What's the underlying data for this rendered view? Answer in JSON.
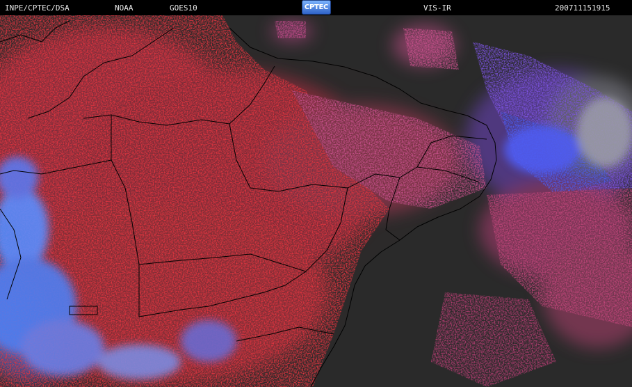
{
  "header": {
    "organization": "INPE/CPTEC/DSA",
    "agency": "NOAA",
    "satellite": "GOES10",
    "logo_text": "CPTEC",
    "channel": "VIS-IR",
    "timestamp": "200711151915"
  },
  "colors": {
    "background": "#2a2a2a",
    "land_fill": "#2c2a2a",
    "cloud_red": "#d63848",
    "cloud_magenta": "#c8508c",
    "cloud_purple": "#7a4cd8",
    "cloud_blue": "#4a7cff",
    "cloud_gray": "#8a8a96",
    "boundary_line": "#000000"
  },
  "map": {
    "region": "Northeast Brazil",
    "layers": [
      "coastline",
      "state-borders",
      "cloud-cover"
    ]
  }
}
